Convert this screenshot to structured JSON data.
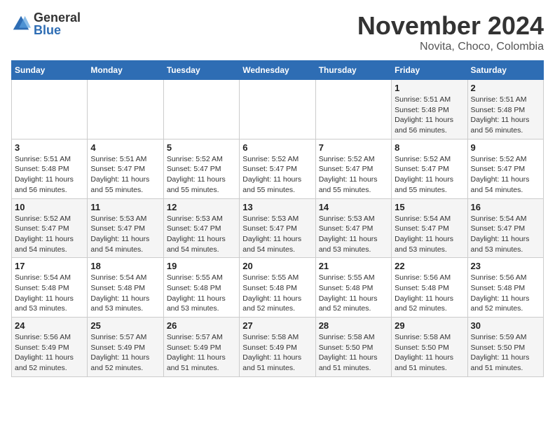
{
  "header": {
    "logo_general": "General",
    "logo_blue": "Blue",
    "month": "November 2024",
    "location": "Novita, Choco, Colombia"
  },
  "days_of_week": [
    "Sunday",
    "Monday",
    "Tuesday",
    "Wednesday",
    "Thursday",
    "Friday",
    "Saturday"
  ],
  "weeks": [
    [
      {
        "day": "",
        "info": ""
      },
      {
        "day": "",
        "info": ""
      },
      {
        "day": "",
        "info": ""
      },
      {
        "day": "",
        "info": ""
      },
      {
        "day": "",
        "info": ""
      },
      {
        "day": "1",
        "info": "Sunrise: 5:51 AM\nSunset: 5:48 PM\nDaylight: 11 hours and 56 minutes."
      },
      {
        "day": "2",
        "info": "Sunrise: 5:51 AM\nSunset: 5:48 PM\nDaylight: 11 hours and 56 minutes."
      }
    ],
    [
      {
        "day": "3",
        "info": "Sunrise: 5:51 AM\nSunset: 5:48 PM\nDaylight: 11 hours and 56 minutes."
      },
      {
        "day": "4",
        "info": "Sunrise: 5:51 AM\nSunset: 5:47 PM\nDaylight: 11 hours and 55 minutes."
      },
      {
        "day": "5",
        "info": "Sunrise: 5:52 AM\nSunset: 5:47 PM\nDaylight: 11 hours and 55 minutes."
      },
      {
        "day": "6",
        "info": "Sunrise: 5:52 AM\nSunset: 5:47 PM\nDaylight: 11 hours and 55 minutes."
      },
      {
        "day": "7",
        "info": "Sunrise: 5:52 AM\nSunset: 5:47 PM\nDaylight: 11 hours and 55 minutes."
      },
      {
        "day": "8",
        "info": "Sunrise: 5:52 AM\nSunset: 5:47 PM\nDaylight: 11 hours and 55 minutes."
      },
      {
        "day": "9",
        "info": "Sunrise: 5:52 AM\nSunset: 5:47 PM\nDaylight: 11 hours and 54 minutes."
      }
    ],
    [
      {
        "day": "10",
        "info": "Sunrise: 5:52 AM\nSunset: 5:47 PM\nDaylight: 11 hours and 54 minutes."
      },
      {
        "day": "11",
        "info": "Sunrise: 5:53 AM\nSunset: 5:47 PM\nDaylight: 11 hours and 54 minutes."
      },
      {
        "day": "12",
        "info": "Sunrise: 5:53 AM\nSunset: 5:47 PM\nDaylight: 11 hours and 54 minutes."
      },
      {
        "day": "13",
        "info": "Sunrise: 5:53 AM\nSunset: 5:47 PM\nDaylight: 11 hours and 54 minutes."
      },
      {
        "day": "14",
        "info": "Sunrise: 5:53 AM\nSunset: 5:47 PM\nDaylight: 11 hours and 53 minutes."
      },
      {
        "day": "15",
        "info": "Sunrise: 5:54 AM\nSunset: 5:47 PM\nDaylight: 11 hours and 53 minutes."
      },
      {
        "day": "16",
        "info": "Sunrise: 5:54 AM\nSunset: 5:47 PM\nDaylight: 11 hours and 53 minutes."
      }
    ],
    [
      {
        "day": "17",
        "info": "Sunrise: 5:54 AM\nSunset: 5:48 PM\nDaylight: 11 hours and 53 minutes."
      },
      {
        "day": "18",
        "info": "Sunrise: 5:54 AM\nSunset: 5:48 PM\nDaylight: 11 hours and 53 minutes."
      },
      {
        "day": "19",
        "info": "Sunrise: 5:55 AM\nSunset: 5:48 PM\nDaylight: 11 hours and 53 minutes."
      },
      {
        "day": "20",
        "info": "Sunrise: 5:55 AM\nSunset: 5:48 PM\nDaylight: 11 hours and 52 minutes."
      },
      {
        "day": "21",
        "info": "Sunrise: 5:55 AM\nSunset: 5:48 PM\nDaylight: 11 hours and 52 minutes."
      },
      {
        "day": "22",
        "info": "Sunrise: 5:56 AM\nSunset: 5:48 PM\nDaylight: 11 hours and 52 minutes."
      },
      {
        "day": "23",
        "info": "Sunrise: 5:56 AM\nSunset: 5:48 PM\nDaylight: 11 hours and 52 minutes."
      }
    ],
    [
      {
        "day": "24",
        "info": "Sunrise: 5:56 AM\nSunset: 5:49 PM\nDaylight: 11 hours and 52 minutes."
      },
      {
        "day": "25",
        "info": "Sunrise: 5:57 AM\nSunset: 5:49 PM\nDaylight: 11 hours and 52 minutes."
      },
      {
        "day": "26",
        "info": "Sunrise: 5:57 AM\nSunset: 5:49 PM\nDaylight: 11 hours and 51 minutes."
      },
      {
        "day": "27",
        "info": "Sunrise: 5:58 AM\nSunset: 5:49 PM\nDaylight: 11 hours and 51 minutes."
      },
      {
        "day": "28",
        "info": "Sunrise: 5:58 AM\nSunset: 5:50 PM\nDaylight: 11 hours and 51 minutes."
      },
      {
        "day": "29",
        "info": "Sunrise: 5:58 AM\nSunset: 5:50 PM\nDaylight: 11 hours and 51 minutes."
      },
      {
        "day": "30",
        "info": "Sunrise: 5:59 AM\nSunset: 5:50 PM\nDaylight: 11 hours and 51 minutes."
      }
    ]
  ]
}
